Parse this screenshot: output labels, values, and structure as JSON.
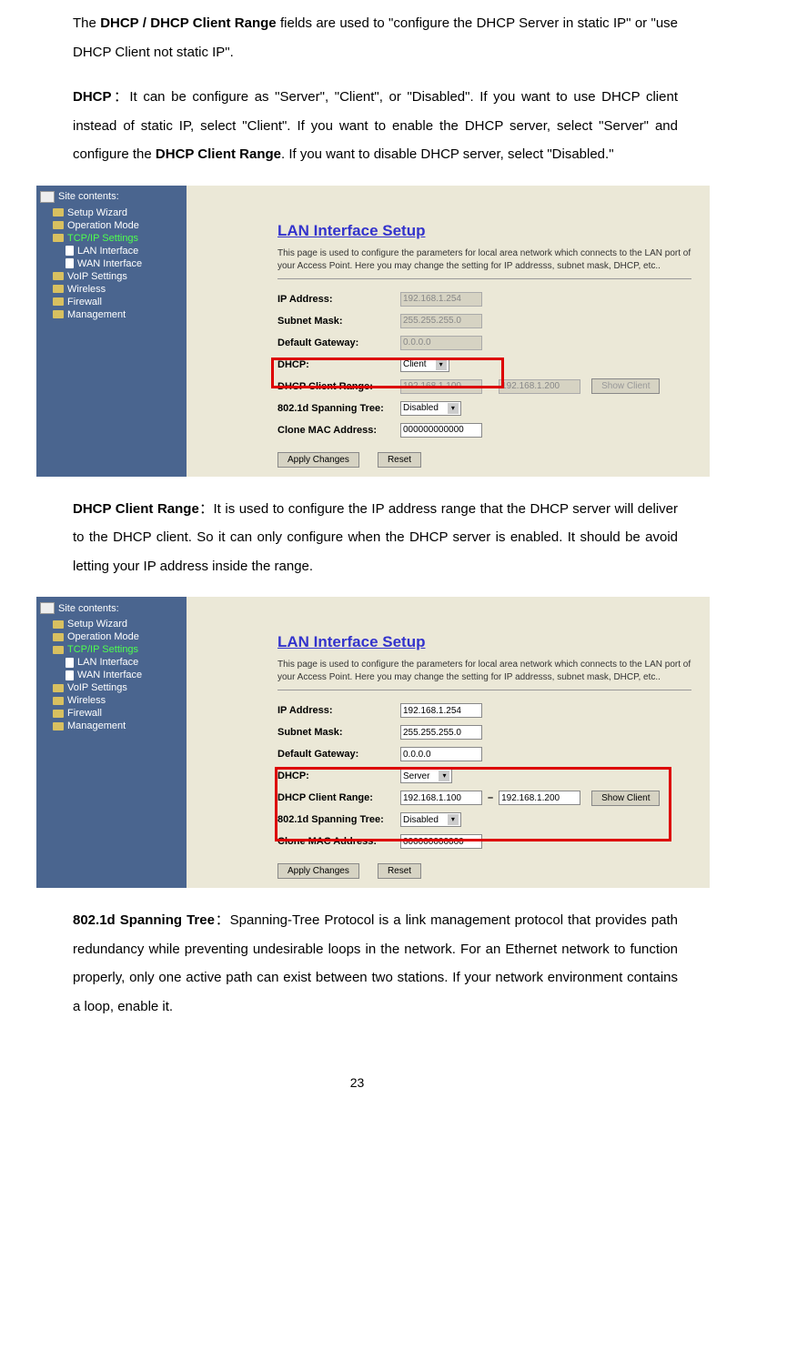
{
  "para1_parts": {
    "a": "The ",
    "b": "DHCP / DHCP Client Range",
    "c": " fields are used to \"configure the DHCP Server in static IP\" or \"use DHCP Client not static IP\"."
  },
  "para2_parts": {
    "a": "DHCP",
    "b": "：It can be configure as \"Server\", \"Client\", or \"Disabled\". If you want to use DHCP client instead of static IP, select \"Client\". If you want to enable the DHCP server, select \"Server\" and configure the ",
    "c": "DHCP Client Range",
    "d": ". If you want to disable DHCP server, select \"Disabled.\""
  },
  "para3_parts": {
    "a": "DHCP Client Range",
    "b": "：It is used to configure the IP address range that the DHCP server will deliver to the DHCP client. So it can only configure when the DHCP server is enabled. It should be avoid letting your IP address inside the range."
  },
  "para4_parts": {
    "a": "802.1d Spanning Tree",
    "b": "：Spanning-Tree Protocol is a link management protocol that provides path redundancy while preventing undesirable loops in the network. For an Ethernet network to function properly, only one active path can exist between two stations. If your network environment contains a loop, enable it."
  },
  "sidebar": {
    "title": "Site contents:",
    "items": [
      "Setup Wizard",
      "Operation Mode",
      "TCP/IP Settings",
      "VoIP Settings",
      "Wireless",
      "Firewall",
      "Management"
    ],
    "subitems": [
      "LAN Interface",
      "WAN Interface"
    ]
  },
  "panel": {
    "title": "LAN Interface Setup",
    "desc": "This page is used to configure the parameters for local area network which connects to the LAN port of your Access Point. Here you may change the setting for IP addresss, subnet mask, DHCP, etc..",
    "labels": {
      "ip": "IP Address:",
      "subnet": "Subnet Mask:",
      "gateway": "Default Gateway:",
      "dhcp": "DHCP:",
      "range": "DHCP Client Range:",
      "spanning": "802.1d Spanning Tree:",
      "clone": "Clone MAC Address:"
    },
    "values": {
      "ip": "192.168.1.254",
      "subnet": "255.255.255.0",
      "gateway": "0.0.0.0",
      "range_start": "192.168.1.100",
      "range_end": "192.168.1.200",
      "clone": "000000000000"
    },
    "dhcp_client": "Client",
    "dhcp_server": "Server",
    "spanning_val": "Disabled",
    "buttons": {
      "showclient": "Show Client",
      "apply": "Apply Changes",
      "reset": "Reset"
    }
  },
  "pagenum": "23"
}
